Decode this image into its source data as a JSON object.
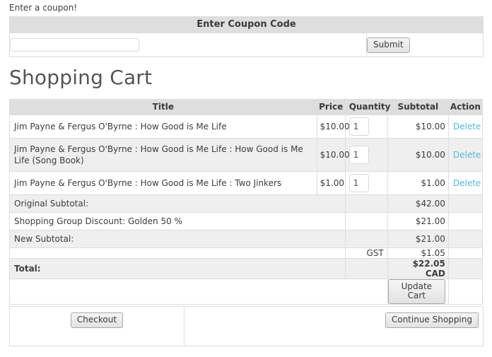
{
  "coupon": {
    "prompt": "Enter a coupon!",
    "header": "Enter Coupon Code",
    "input_value": "",
    "input_placeholder": "",
    "submit_label": "Submit"
  },
  "page_title": "Shopping Cart",
  "cart": {
    "columns": {
      "title": "Title",
      "price": "Price",
      "quantity": "Quantity",
      "subtotal": "Subtotal",
      "action": "Action"
    },
    "items": [
      {
        "title": "Jim Payne & Fergus O'Byrne : How Good is Me Life",
        "price": "$10.00",
        "quantity": "1",
        "subtotal": "$10.00",
        "action": "Delete"
      },
      {
        "title": "Jim Payne & Fergus O'Byrne : How Good is Me Life : How Good is Me Life (Song Book)",
        "price": "$10.00",
        "quantity": "1",
        "subtotal": "$10.00",
        "action": "Delete"
      },
      {
        "title": "Jim Payne & Fergus O'Byrne : How Good is Me Life : Two Jinkers",
        "price": "$1.00",
        "quantity": "1",
        "subtotal": "$1.00",
        "action": "Delete"
      }
    ],
    "summary": [
      {
        "label": "Original Subtotal:",
        "mid": "",
        "value": "$42.00"
      },
      {
        "label": "Shopping Group Discount: Golden 50 %",
        "mid": "",
        "value": "$21.00"
      },
      {
        "label": "New Subtotal:",
        "mid": "",
        "value": "$21.00"
      },
      {
        "label": "",
        "mid": "GST",
        "value": "$1.05"
      },
      {
        "label": "Total:",
        "mid": "",
        "value": "$22.05 CAD"
      }
    ],
    "update_label": "Update Cart"
  },
  "actions": {
    "checkout_label": "Checkout",
    "continue_label": "Continue Shopping"
  },
  "colors": {
    "header_bg": "#dedede",
    "row_alt_bg": "#efefef",
    "border": "#dddddd",
    "link": "#53b9dc",
    "text": "#3c3c3c",
    "title_text": "#555555"
  }
}
